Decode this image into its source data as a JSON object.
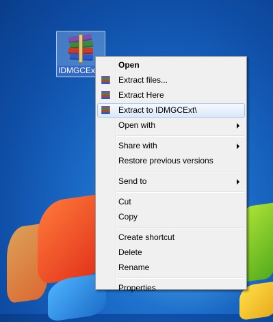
{
  "desktop": {
    "icon_label": "IDMGCExt",
    "icon_name": "winrar-archive-icon"
  },
  "context_menu": {
    "items": [
      {
        "label": "Open",
        "bold": true
      },
      {
        "label": "Extract files...",
        "icon": "winrar-icon"
      },
      {
        "label": "Extract Here",
        "icon": "winrar-icon"
      },
      {
        "label": "Extract to IDMGCExt\\",
        "icon": "winrar-icon",
        "highlighted": true
      },
      {
        "label": "Open with",
        "submenu": true
      },
      {
        "label": "Share with",
        "submenu": true
      },
      {
        "label": "Restore previous versions"
      },
      {
        "label": "Send to",
        "submenu": true
      },
      {
        "label": "Cut"
      },
      {
        "label": "Copy"
      },
      {
        "label": "Create shortcut"
      },
      {
        "label": "Delete"
      },
      {
        "label": "Rename"
      },
      {
        "label": "Properties"
      }
    ]
  },
  "colors": {
    "menu_background": "#f0f0f0",
    "highlight_border": "#aac8ee",
    "icon_label_selection": "#3569c9"
  }
}
